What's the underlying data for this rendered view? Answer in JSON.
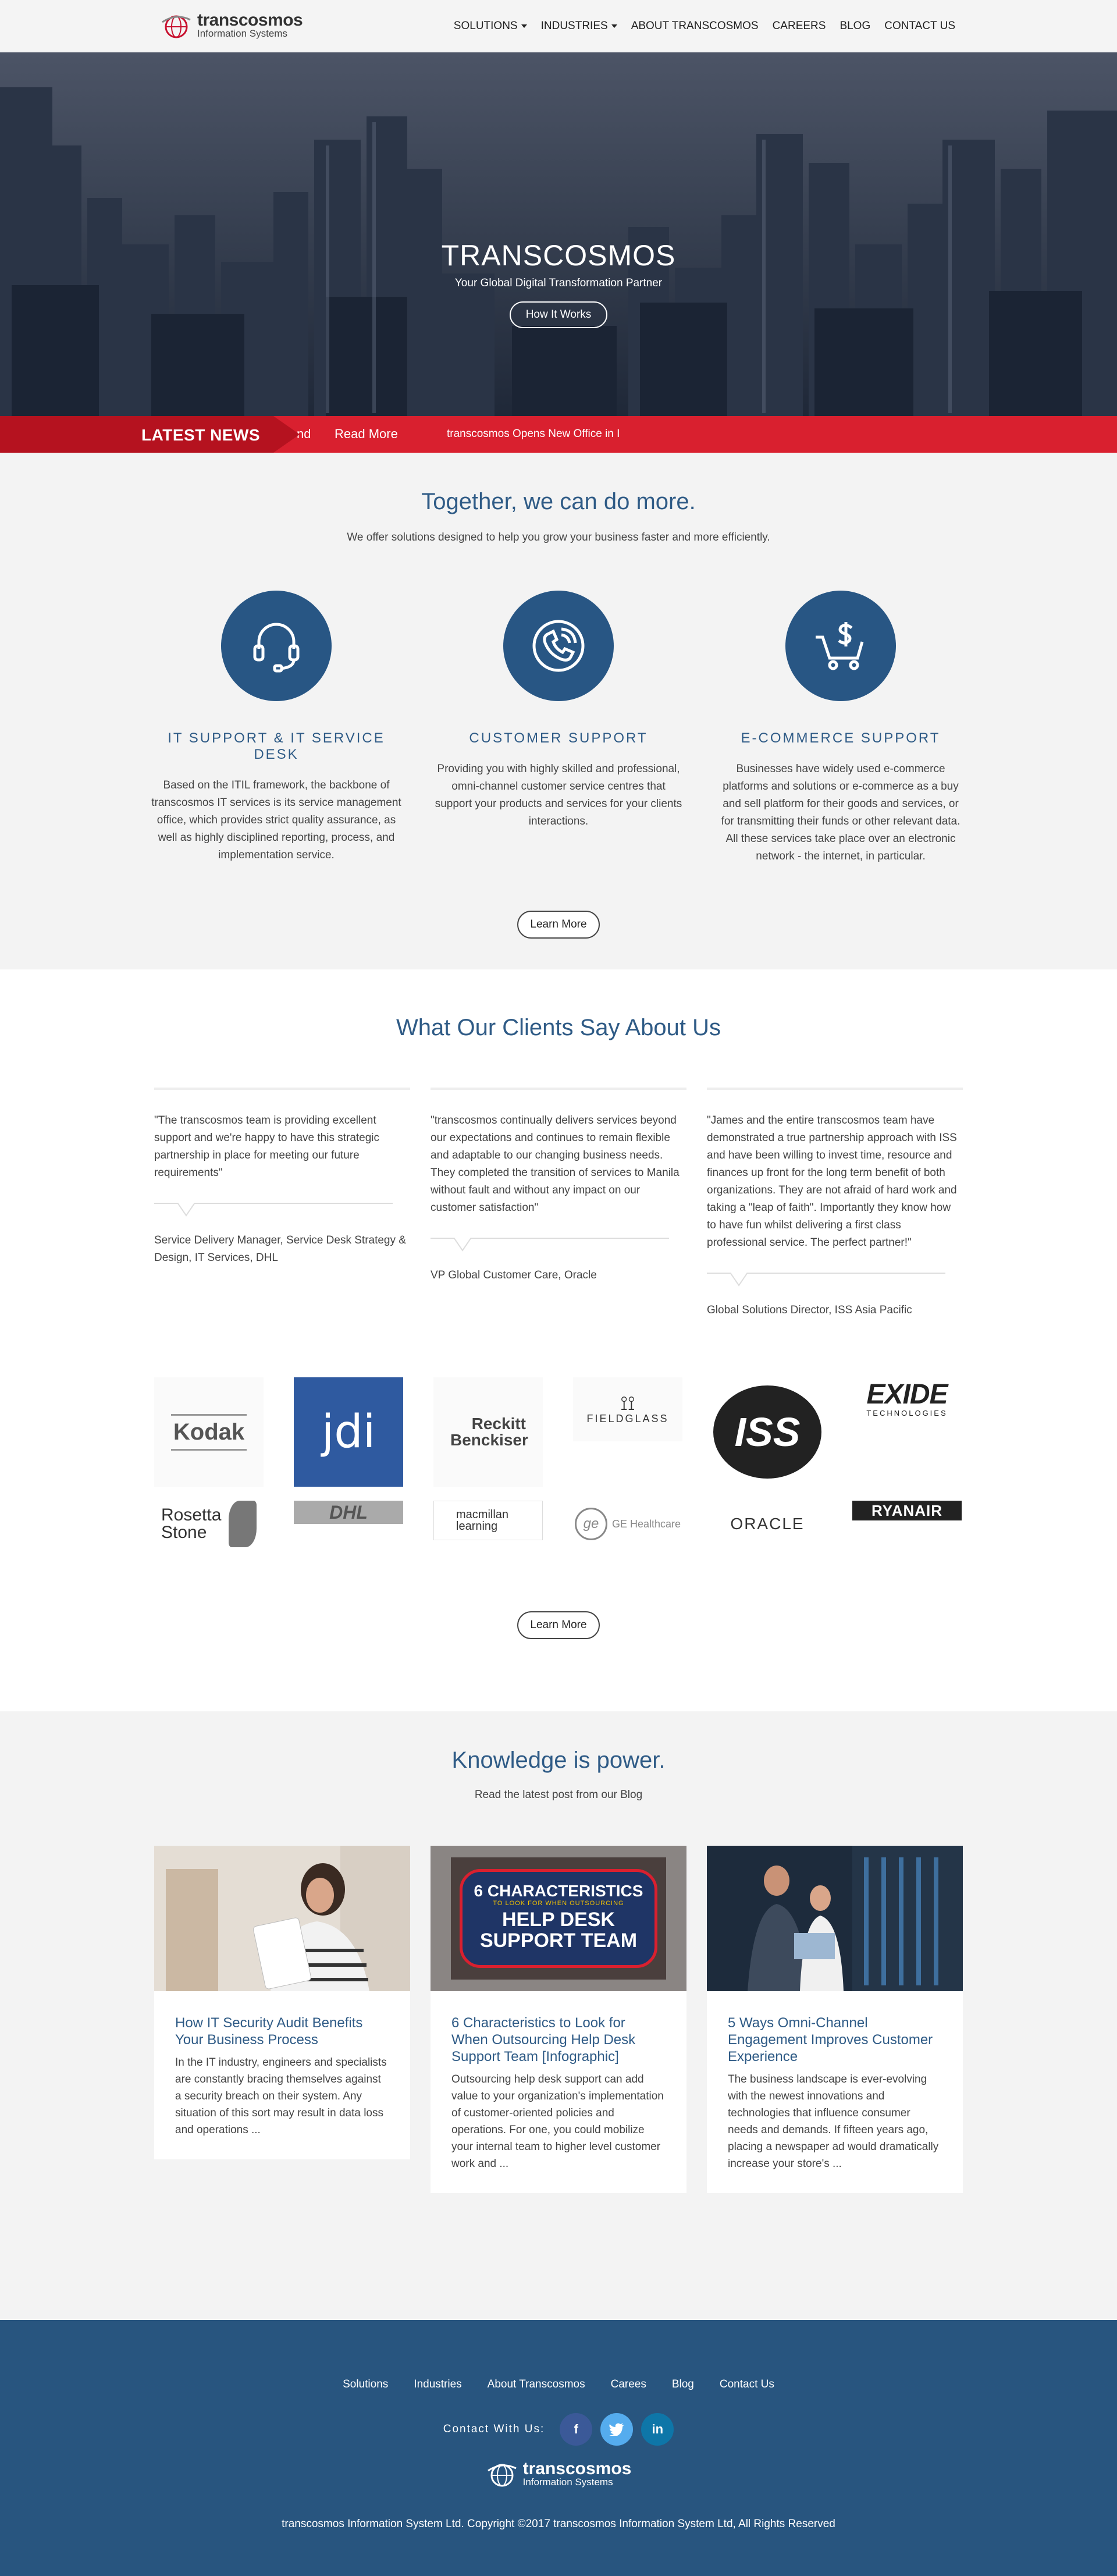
{
  "brand": {
    "name_line1": "transcosmos",
    "name_line2": "Information Systems"
  },
  "nav": {
    "items": [
      {
        "label": "SOLUTIONS",
        "dropdown": true
      },
      {
        "label": "INDUSTRIES",
        "dropdown": true
      },
      {
        "label": "ABOUT TRANSCOSMOS",
        "dropdown": false
      },
      {
        "label": "CAREERS",
        "dropdown": false
      },
      {
        "label": "BLOG",
        "dropdown": false
      },
      {
        "label": "CONTACT US",
        "dropdown": false
      }
    ]
  },
  "hero": {
    "title": "TRANSCOSMOS",
    "subtitle": "Your Global Digital Transformation Partner",
    "button": "How It Works"
  },
  "news": {
    "label": "LATEST NEWS",
    "fragment": "nd",
    "read_more": "Read More",
    "headline": "transcosmos Opens New Office in I"
  },
  "intro": {
    "title": "Together, we can do more.",
    "lead": "We offer solutions designed to help you grow your business faster and more efficiently."
  },
  "services": [
    {
      "icon": "headset-icon",
      "title": "IT SUPPORT & IT SERVICE DESK",
      "text": "Based on the ITIL framework, the backbone of transcosmos IT services is its service management office, which provides strict quality assurance, as well as highly disciplined reporting, process, and implementation service."
    },
    {
      "icon": "phone-icon",
      "title": "CUSTOMER SUPPORT",
      "text": "Providing you with highly skilled and professional, omni-channel customer service centres that support your products and services for your clients interactions."
    },
    {
      "icon": "cart-dollar-icon",
      "title": "E-COMMERCE SUPPORT",
      "text": "Businesses have widely used e-commerce platforms and solutions or e-commerce as a buy and sell platform for their goods and services, or for transmitting their funds or other relevant data. All these services take place over an electronic network - the internet, in particular."
    }
  ],
  "services_button": "Learn More",
  "clients": {
    "title": "What Our Clients Say About Us",
    "testimonials": [
      {
        "quote": "\"The transcosmos team is providing excellent support and we're happy to have this strategic partnership in place for meeting our future requirements\"",
        "author": "Service Delivery Manager, Service Desk Strategy & Design, IT Services, DHL"
      },
      {
        "quote": "\"transcosmos continually delivers services beyond our expectations and continues to remain flexible and adaptable to our changing business needs. They completed the transition of services to Manila without fault and without any impact on our customer satisfaction\"",
        "author": "VP Global Customer Care, Oracle"
      },
      {
        "quote": "\"James and the entire transcosmos team have demonstrated a true partnership approach with ISS and have been willing to invest time, resource and finances up front for the long term benefit of both organizations. They are not afraid of hard work and taking a \"leap of faith\". Importantly they know how to have fun whilst delivering a first class professional service. The perfect partner!\"",
        "author": "Global Solutions Director, ISS Asia Pacific"
      }
    ],
    "logos_row1": [
      "Kodak",
      "jdi",
      "Reckitt Benckiser",
      "FIELDGLASS",
      "ISS",
      "EXIDE"
    ],
    "logos_row1_sub": {
      "exide": "TECHNOLOGIES"
    },
    "logos_row2": [
      "Rosetta Stone",
      "DHL",
      "macmillan learning",
      "GE Healthcare",
      "ORACLE",
      "RYANAIR"
    ],
    "button": "Learn More"
  },
  "blog": {
    "title": "Knowledge is power.",
    "lead": "Read the latest post from our Blog",
    "posts": [
      {
        "title": "How IT Security Audit Benefits Your Business Process",
        "excerpt": "In the IT industry, engineers and specialists are constantly bracing themselves against a security breach on their system. Any situation of this sort may result in data loss and operations ..."
      },
      {
        "title": "6 Characteristics to Look for When Outsourcing Help Desk Support Team [Infographic]",
        "excerpt": "Outsourcing help desk support can add value to your organization's implementation of customer-oriented policies and operations. For one, you could mobilize your internal team to higher level customer work and ...",
        "image_text": {
          "line1": "6 CHARACTERISTICS",
          "line2": "TO LOOK FOR WHEN OUTSOURCING",
          "line3": "HELP DESK",
          "line4": "SUPPORT TEAM"
        }
      },
      {
        "title": "5 Ways Omni-Channel Engagement Improves Customer Experience",
        "excerpt": "The business landscape is ever-evolving with the newest innovations and technologies that influence consumer needs and demands. If fifteen years ago, placing a newspaper ad would dramatically increase your store's ..."
      }
    ]
  },
  "footer": {
    "links": [
      "Solutions",
      "Industries",
      "About Transcosmos",
      "Carees",
      "Blog",
      "Contact Us"
    ],
    "contact_label": "Contact With Us:",
    "social": [
      {
        "icon": "facebook-icon",
        "glyph": "f",
        "color": "#3b5998"
      },
      {
        "icon": "twitter-icon",
        "glyph": "t",
        "color": "#55acee"
      },
      {
        "icon": "linkedin-icon",
        "glyph": "in",
        "color": "#0e76a8"
      }
    ],
    "copyright": "transcosmos Information System Ltd. Copyright ©2017 transcosmos Information System Ltd, All Rights Reserved"
  },
  "colors": {
    "brand_blue": "#28557f",
    "heading_blue": "#2f5b86",
    "news_red": "#d9202f"
  }
}
